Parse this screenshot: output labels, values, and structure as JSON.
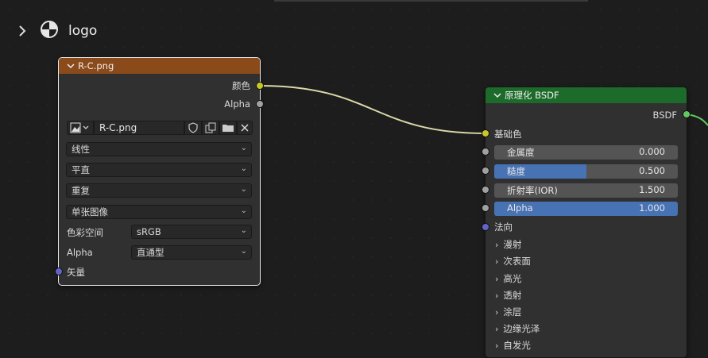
{
  "breadcrumb": {
    "label": "logo"
  },
  "image_node": {
    "title": "R-C.png",
    "header_color": "#8a4a1a",
    "outputs": [
      "颜色",
      "Alpha"
    ],
    "image_name": "R-C.png",
    "interpolation": "线性",
    "projection": "平直",
    "extension": "重复",
    "source": "单张图像",
    "color_space_label": "色彩空间",
    "color_space": "sRGB",
    "alpha_label": "Alpha",
    "alpha_mode": "直通型",
    "vector_label": "矢量"
  },
  "bsdf_node": {
    "title": "原理化 BSDF",
    "header_color": "#1d6b2a",
    "output": "BSDF",
    "base_color_label": "基础色",
    "inputs": [
      {
        "label": "金属度",
        "value": "0.000",
        "fill": 0.0
      },
      {
        "label": "糙度",
        "value": "0.500",
        "fill": 0.5
      },
      {
        "label": "折射率(IOR)",
        "value": "1.500",
        "fill": 0.0
      },
      {
        "label": "Alpha",
        "value": "1.000",
        "fill": 1.0
      }
    ],
    "normal_label": "法向",
    "panels": [
      "漫射",
      "次表面",
      "高光",
      "透射",
      "涂层",
      "边缘光泽",
      "自发光"
    ]
  }
}
